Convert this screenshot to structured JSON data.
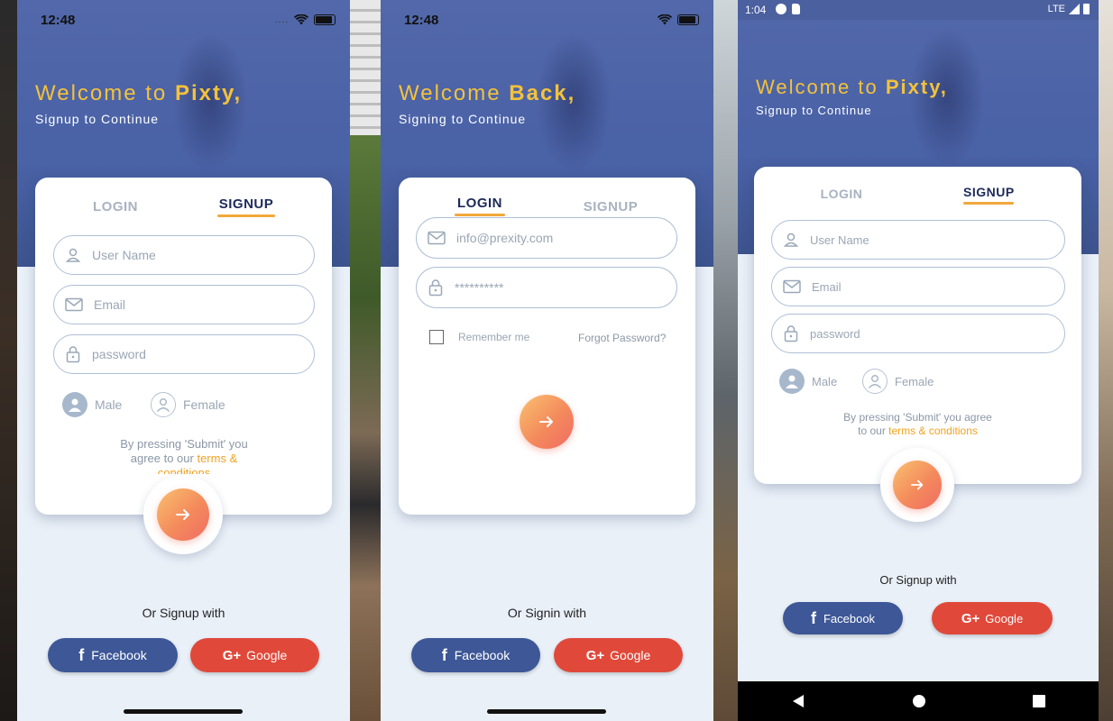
{
  "colors": {
    "brand_yellow": "#f3c23b",
    "hero_blue": "#4a62a6",
    "accent_orange": "#f2a83a",
    "facebook": "#3d5797",
    "google": "#e0493a"
  },
  "screen1": {
    "status": {
      "time": "12:48",
      "dots": "...."
    },
    "welcome_prefix": "Welcome to ",
    "welcome_brand": "Pixty,",
    "subtitle": "Signup to Continue",
    "tabs": {
      "login": "LOGIN",
      "signup": "SIGNUP"
    },
    "fields": {
      "username": "User Name",
      "email": "Email",
      "password": "password"
    },
    "gender": {
      "male": "Male",
      "female": "Female"
    },
    "terms": {
      "line1": "By pressing 'Submit' you",
      "line2": "agree to our ",
      "link1": "terms &",
      "link2": "conditions"
    },
    "or_text": "Or Signup with",
    "social": {
      "facebook": "Facebook",
      "google": "Google",
      "facebook_icon": "f",
      "google_icon": "G+"
    }
  },
  "screen2": {
    "status": {
      "time": "12:48"
    },
    "welcome_prefix": "Welcome ",
    "welcome_brand": "Back,",
    "subtitle": "Signing to Continue",
    "tabs": {
      "login": "LOGIN",
      "signup": "SIGNUP"
    },
    "fields": {
      "email": "info@prexity.com",
      "password": "**********"
    },
    "remember": "Remember me",
    "forgot": "Forgot Password?",
    "or_text": "Or Signin with",
    "social": {
      "facebook": "Facebook",
      "google": "Google",
      "facebook_icon": "f",
      "google_icon": "G+"
    }
  },
  "screen3": {
    "status": {
      "time": "1:04",
      "network": "LTE"
    },
    "welcome_prefix": "Welcome to ",
    "welcome_brand": "Pixty,",
    "subtitle": "Signup to Continue",
    "tabs": {
      "login": "LOGIN",
      "signup": "SIGNUP"
    },
    "fields": {
      "username": "User Name",
      "email": "Email",
      "password": "password"
    },
    "gender": {
      "male": "Male",
      "female": "Female"
    },
    "terms": {
      "line1": "By pressing 'Submit' you agree",
      "line2": "to our ",
      "link": "terms & conditions"
    },
    "or_text": "Or Signup with",
    "social": {
      "facebook": "Facebook",
      "google": "Google",
      "facebook_icon": "f",
      "google_icon": "G+"
    }
  }
}
